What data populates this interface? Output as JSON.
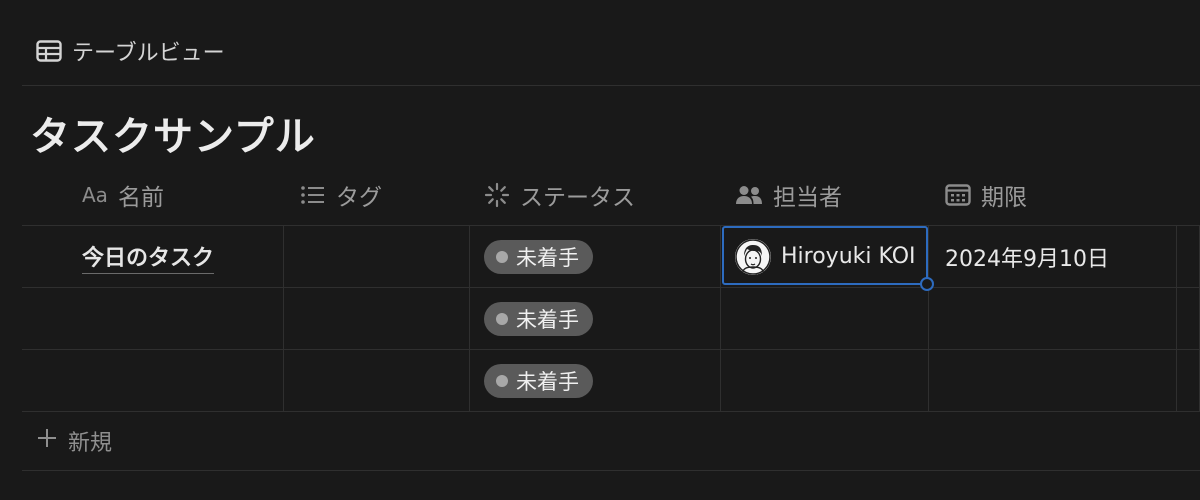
{
  "view": {
    "icon": "table-icon",
    "label": "テーブルビュー"
  },
  "database": {
    "title": "タスクサンプル"
  },
  "columns": [
    {
      "icon": "Aa",
      "label": "名前"
    },
    {
      "icon": "list-icon",
      "label": "タグ"
    },
    {
      "icon": "status-spinner-icon",
      "label": "ステータス"
    },
    {
      "icon": "people-icon",
      "label": "担当者"
    },
    {
      "icon": "calendar-icon",
      "label": "期限"
    }
  ],
  "rows": [
    {
      "name": "今日のタスク",
      "tag": "",
      "status": "未着手",
      "assignee": "Hiroyuki KOI",
      "due": "2024年9月10日"
    },
    {
      "name": "",
      "tag": "",
      "status": "未着手",
      "assignee": "",
      "due": ""
    },
    {
      "name": "",
      "tag": "",
      "status": "未着手",
      "assignee": "",
      "due": ""
    }
  ],
  "new_row": {
    "label": "新規"
  },
  "colors": {
    "background": "#191919",
    "pill": "#5a5a5a",
    "selection": "#2d6bbf"
  }
}
